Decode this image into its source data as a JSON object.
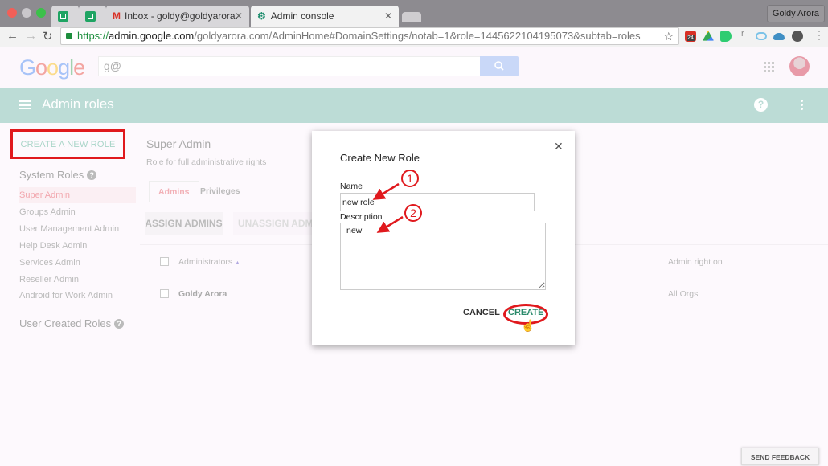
{
  "browser": {
    "tabs": [
      {
        "label": "",
        "icon": "sheets-icon"
      },
      {
        "label": "",
        "icon": "sheets-icon"
      },
      {
        "label": "Inbox - goldy@goldyarora.com",
        "icon": "gmail-icon"
      },
      {
        "label": "Admin console",
        "icon": "admin-console-icon",
        "active": true
      }
    ],
    "profile_name": "Goldy Arora",
    "url": {
      "scheme": "https://",
      "domain": "admin.google.com",
      "path": "/goldyarora.com/AdminHome#DomainSettings/notab=1&role=1445622104195073&subtab=roles"
    },
    "extension_badge": "24"
  },
  "header": {
    "logo": "Google",
    "search_value": "g@"
  },
  "appbar": {
    "title": "Admin roles"
  },
  "sidebar": {
    "create_button": "CREATE A NEW ROLE",
    "system_roles_title": "System Roles",
    "system_roles": [
      {
        "label": "Super Admin",
        "selected": true
      },
      {
        "label": "Groups Admin"
      },
      {
        "label": "User Management Admin"
      },
      {
        "label": "Help Desk Admin"
      },
      {
        "label": "Services Admin"
      },
      {
        "label": "Reseller Admin"
      },
      {
        "label": "Android for Work Admin"
      }
    ],
    "user_roles_title": "User Created Roles"
  },
  "main": {
    "title": "Super Admin",
    "subtitle": "Role for full administrative rights",
    "tabs": [
      {
        "label": "Admins",
        "active": true
      },
      {
        "label": "Privileges"
      }
    ],
    "assign_button": "ASSIGN ADMINS",
    "unassign_button": "UNASSIGN ADMINS",
    "table": {
      "columns": [
        "Administrators",
        "Admin right on"
      ],
      "sort_indicator": "▲",
      "rows": [
        {
          "name": "Goldy Arora",
          "scope": "All Orgs"
        }
      ]
    }
  },
  "dialog": {
    "title": "Create New Role",
    "name_label": "Name",
    "name_value": "new role",
    "description_label": "Description",
    "description_value": "new",
    "cancel_label": "CANCEL",
    "create_label": "CREATE",
    "annotations": [
      "1",
      "2"
    ]
  },
  "feedback_button": "SEND FEEDBACK",
  "colors": {
    "appbar": "#bcdcd6",
    "annotation_red": "#e0191d",
    "create_green": "#2a8a6a"
  }
}
